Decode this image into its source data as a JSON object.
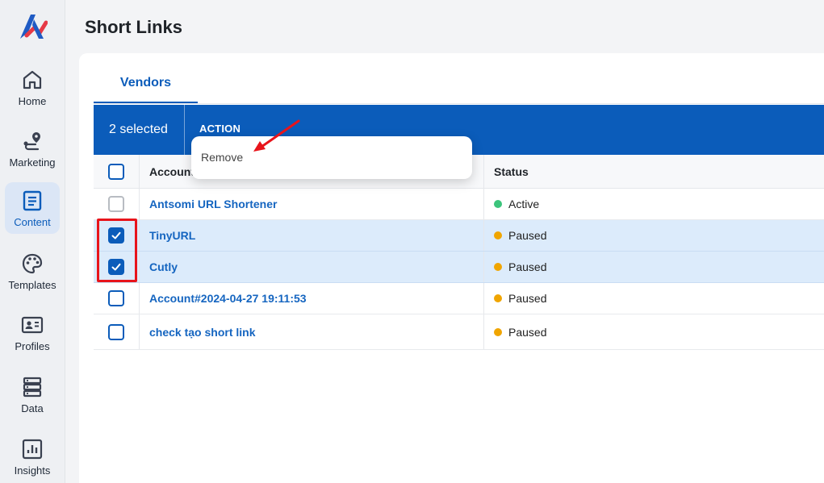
{
  "sidebar": {
    "logo": "antsomi-logo-icon",
    "items": [
      {
        "label": "Home",
        "icon": "home-icon",
        "active": false
      },
      {
        "label": "Marketing",
        "icon": "route-pin-icon",
        "active": false
      },
      {
        "label": "Content",
        "icon": "document-icon",
        "active": true
      },
      {
        "label": "Templates",
        "icon": "palette-icon",
        "active": false
      },
      {
        "label": "Profiles",
        "icon": "id-card-icon",
        "active": false
      },
      {
        "label": "Data",
        "icon": "database-icon",
        "active": false
      },
      {
        "label": "Insights",
        "icon": "chart-icon",
        "active": false
      }
    ]
  },
  "header": {
    "title": "Short Links"
  },
  "tabs": [
    {
      "label": "Vendors",
      "active": true
    }
  ],
  "selection_bar": {
    "count_label": "2 selected",
    "action_label": "ACTION"
  },
  "dropdown": {
    "items": [
      {
        "label": "Remove"
      }
    ]
  },
  "table": {
    "columns": [
      "Account",
      "Status"
    ],
    "rows": [
      {
        "name": "Antsomi URL Shortener",
        "status": "Active",
        "checked": false,
        "disabled": true
      },
      {
        "name": "TinyURL",
        "status": "Paused",
        "checked": true,
        "disabled": false
      },
      {
        "name": "Cutly",
        "status": "Paused",
        "checked": true,
        "disabled": false
      },
      {
        "name": "Account#2024-04-27 19:11:53",
        "status": "Paused",
        "checked": false,
        "disabled": false
      },
      {
        "name": "check tạo short link",
        "status": "Paused",
        "checked": false,
        "disabled": false
      }
    ]
  },
  "colors": {
    "primary": "#0b5cba",
    "active_status": "#3cc47c",
    "paused_status": "#f0a500",
    "annotation": "#e8141b"
  }
}
